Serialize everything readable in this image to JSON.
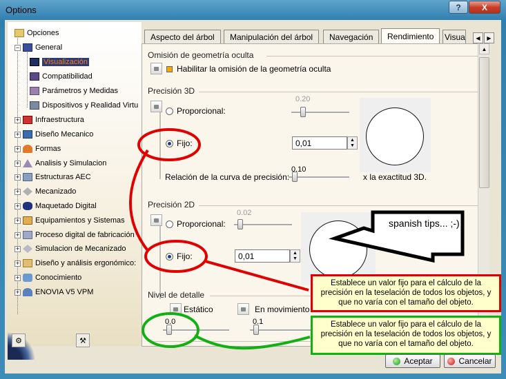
{
  "window": {
    "title": "Options",
    "help_label": "?",
    "close_label": "X"
  },
  "tree": {
    "items": [
      {
        "label": "Opciones"
      },
      {
        "label": "General"
      },
      {
        "label": "Visualización"
      },
      {
        "label": "Compatibilidad"
      },
      {
        "label": "Parámetros y Medidas"
      },
      {
        "label": "Dispositivos y Realidad Virtu"
      },
      {
        "label": "Infraestructura"
      },
      {
        "label": "Diseño Mecanico"
      },
      {
        "label": "Formas"
      },
      {
        "label": "Analisis y Simulacion"
      },
      {
        "label": "Estructuras AEC"
      },
      {
        "label": "Mecanizado"
      },
      {
        "label": "Maquetado Digital"
      },
      {
        "label": "Equipamientos y Sistemas"
      },
      {
        "label": "Proceso digital de fabricación"
      },
      {
        "label": "Simulacion de Mecanizado"
      },
      {
        "label": "Diseño y análisis ergonómico:"
      },
      {
        "label": "Conocimiento"
      },
      {
        "label": "ENOVIA V5 VPM"
      }
    ]
  },
  "tabs": [
    {
      "label": "Aspecto del árbol"
    },
    {
      "label": "Manipulación del árbol"
    },
    {
      "label": "Navegación"
    },
    {
      "label": "Rendimiento"
    },
    {
      "label": "Visua"
    }
  ],
  "nav": {
    "left": "◀",
    "right": "▶",
    "up": "▲",
    "down": "▼"
  },
  "occlusion": {
    "title": "Omisión de geometría oculta",
    "checkbox_label": "Habilitar la omisión de la geometría oculta"
  },
  "precision3d": {
    "title": "Precisión 3D",
    "proportional_label": "Proporcional:",
    "proportional_value": "0.20",
    "fixed_label": "Fijo:",
    "fixed_value": "0,01",
    "curve_label": "Relación de la curva de precisión:",
    "curve_value": "0.10",
    "curve_suffix": "x la exactitud 3D."
  },
  "precision2d": {
    "title": "Precisión 2D",
    "proportional_label": "Proporcional:",
    "proportional_value": "0.02",
    "fixed_label": "Fijo:",
    "fixed_value": "0,01"
  },
  "detail": {
    "title": "Nivel de detalle",
    "static_label": "Estático",
    "moving_label": "En movimiento",
    "static_value": "0.0",
    "moving_value": "0.1"
  },
  "annotations": {
    "note": "spanish tips... ;-)",
    "tip_red": "Establece un valor fijo para el cálculo de la precisión en la teselación de todos los objetos, y que no varía con el tamaño del objeto.",
    "tip_green": "Establece un valor fijo para el cálculo de la precisión en la teselación de todos los objetos, y que no varía con el tamaño del objeto.",
    "red_color": "#e00000",
    "green_color": "#12b012"
  },
  "buttons": {
    "ok_label": "Aceptar",
    "cancel_label": "Cancelar"
  }
}
